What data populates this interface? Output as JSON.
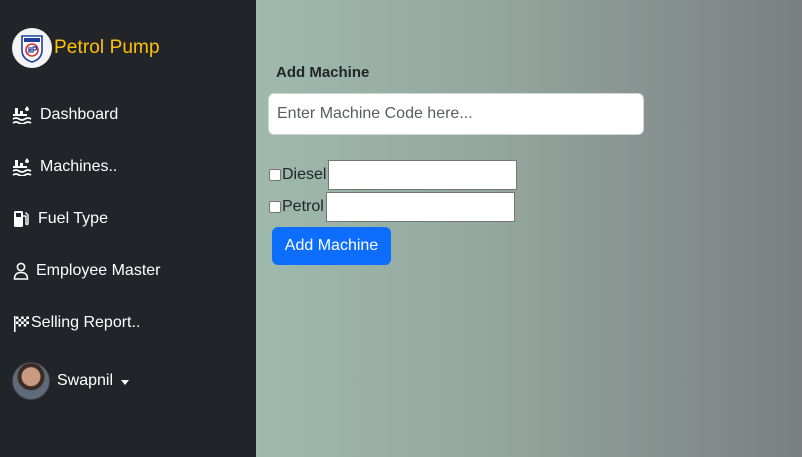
{
  "sidebar": {
    "brand": {
      "logo": "hp-logo",
      "name": "Petrol Pump"
    },
    "items": [
      {
        "label": "Dashboard",
        "icon": "water-icon"
      },
      {
        "label": "Machines..",
        "icon": "water-icon"
      },
      {
        "label": "Fuel Type",
        "icon": "fuel-pump-icon"
      },
      {
        "label": "Employee Master",
        "icon": "person-icon"
      },
      {
        "label": "Selling Report..",
        "icon": "checkered-flag-icon"
      }
    ],
    "user": {
      "name": "Swapnil",
      "avatar": "avatar-photo"
    }
  },
  "form": {
    "title": "Add Machine",
    "code_value": "",
    "code_placeholder": "Enter Machine Code here...",
    "fuels": [
      {
        "label": "Diesel",
        "checked": false,
        "value": ""
      },
      {
        "label": "Petrol",
        "checked": false,
        "value": ""
      }
    ],
    "submit_label": "Add Machine"
  },
  "colors": {
    "sidebar_bg": "#212529",
    "brand": "#ffc107",
    "primary": "#0d6efd"
  }
}
